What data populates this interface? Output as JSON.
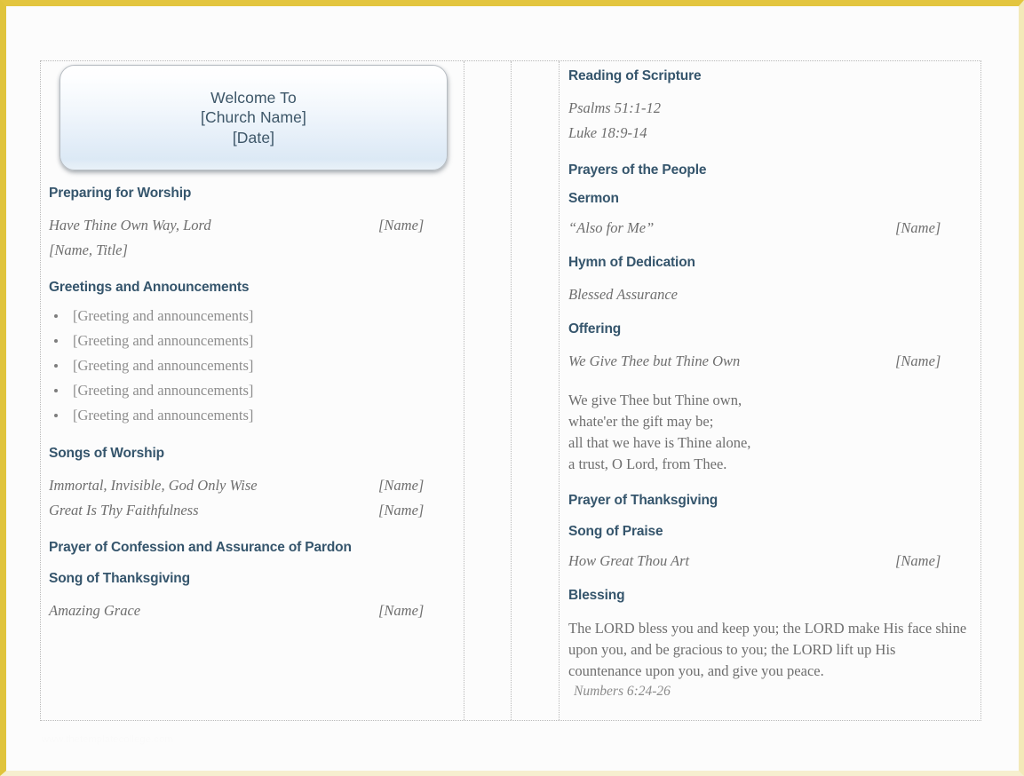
{
  "document": {
    "type": "church-worship-bulletin-template",
    "frame_color": "#e3c53f",
    "heading_color": "#35556c",
    "body_color": "#6e6e6e"
  },
  "banner": {
    "line1": "Welcome To",
    "line2": "[Church Name]",
    "line3": "[Date]"
  },
  "left_column": {
    "preparing": {
      "heading": "Preparing for Worship",
      "song_title": "Have Thine Own Way, Lord",
      "song_name": "[Name]",
      "subline": "[Name, Title]"
    },
    "greetings": {
      "heading": "Greetings and Announcements",
      "items": [
        "[Greeting and announcements]",
        "[Greeting and announcements]",
        "[Greeting and announcements]",
        "[Greeting and announcements]",
        "[Greeting and announcements]"
      ]
    },
    "songs_of_worship": {
      "heading": "Songs of Worship",
      "entries": [
        {
          "title": "Immortal, Invisible, God Only Wise",
          "who": "[Name]"
        },
        {
          "title": "Great Is Thy Faithfulness",
          "who": "[Name]"
        }
      ]
    },
    "confession": {
      "heading": "Prayer of Confession and Assurance of Pardon"
    },
    "thanksgiving_song": {
      "heading": "Song of Thanksgiving",
      "entries": [
        {
          "title": "Amazing Grace",
          "who": "[Name]"
        }
      ]
    }
  },
  "right_column": {
    "scripture": {
      "heading": "Reading of Scripture",
      "readings": [
        "Psalms 51:1-12",
        "Luke 18:9-14"
      ]
    },
    "prayers": {
      "heading": "Prayers of the People"
    },
    "sermon": {
      "heading": "Sermon",
      "entries": [
        {
          "title": "“Also for Me”",
          "who": "[Name]"
        }
      ]
    },
    "hymn_of_dedication": {
      "heading": "Hymn of Dedication",
      "song": "Blessed Assurance"
    },
    "offering": {
      "heading": "Offering",
      "entries": [
        {
          "title": "We Give Thee but Thine Own",
          "who": "[Name]"
        }
      ],
      "verse_lines": [
        "We give Thee but Thine own,",
        "whate'er the gift may be;",
        "all that we have is Thine alone,",
        "a trust, O Lord, from Thee."
      ]
    },
    "prayer_of_thanksgiving": {
      "heading": "Prayer of Thanksgiving"
    },
    "song_of_praise": {
      "heading": "Song of Praise",
      "entries": [
        {
          "title": "How Great Thou Art",
          "who": "[Name]"
        }
      ]
    },
    "blessing": {
      "heading": "Blessing",
      "text": "The LORD bless you and keep you; the LORD make His face shine upon you, and be gracious to you; the LORD lift up His countenance upon you, and give you peace.",
      "reference": "Numbers 6:24-26"
    }
  },
  "footer": {
    "watermark": "www.thetemplatecollege.com"
  }
}
